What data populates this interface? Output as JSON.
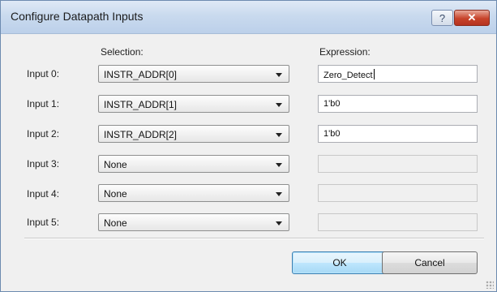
{
  "window": {
    "title": "Configure Datapath Inputs"
  },
  "titlebar": {
    "help_label": "?",
    "close_label": "✕"
  },
  "headers": {
    "selection": "Selection:",
    "expression": "Expression:"
  },
  "rows": [
    {
      "label": "Input 0:",
      "selection": "INSTR_ADDR[0]",
      "expression": "Zero_Detect",
      "enabled": true,
      "focused": true
    },
    {
      "label": "Input 1:",
      "selection": "INSTR_ADDR[1]",
      "expression": "1'b0",
      "enabled": true
    },
    {
      "label": "Input 2:",
      "selection": "INSTR_ADDR[2]",
      "expression": "1'b0",
      "enabled": true
    },
    {
      "label": "Input 3:",
      "selection": "None",
      "expression": "",
      "enabled": false
    },
    {
      "label": "Input 4:",
      "selection": "None",
      "expression": "",
      "enabled": false
    },
    {
      "label": "Input 5:",
      "selection": "None",
      "expression": "",
      "enabled": false
    }
  ],
  "buttons": {
    "ok": "OK",
    "cancel": "Cancel"
  }
}
